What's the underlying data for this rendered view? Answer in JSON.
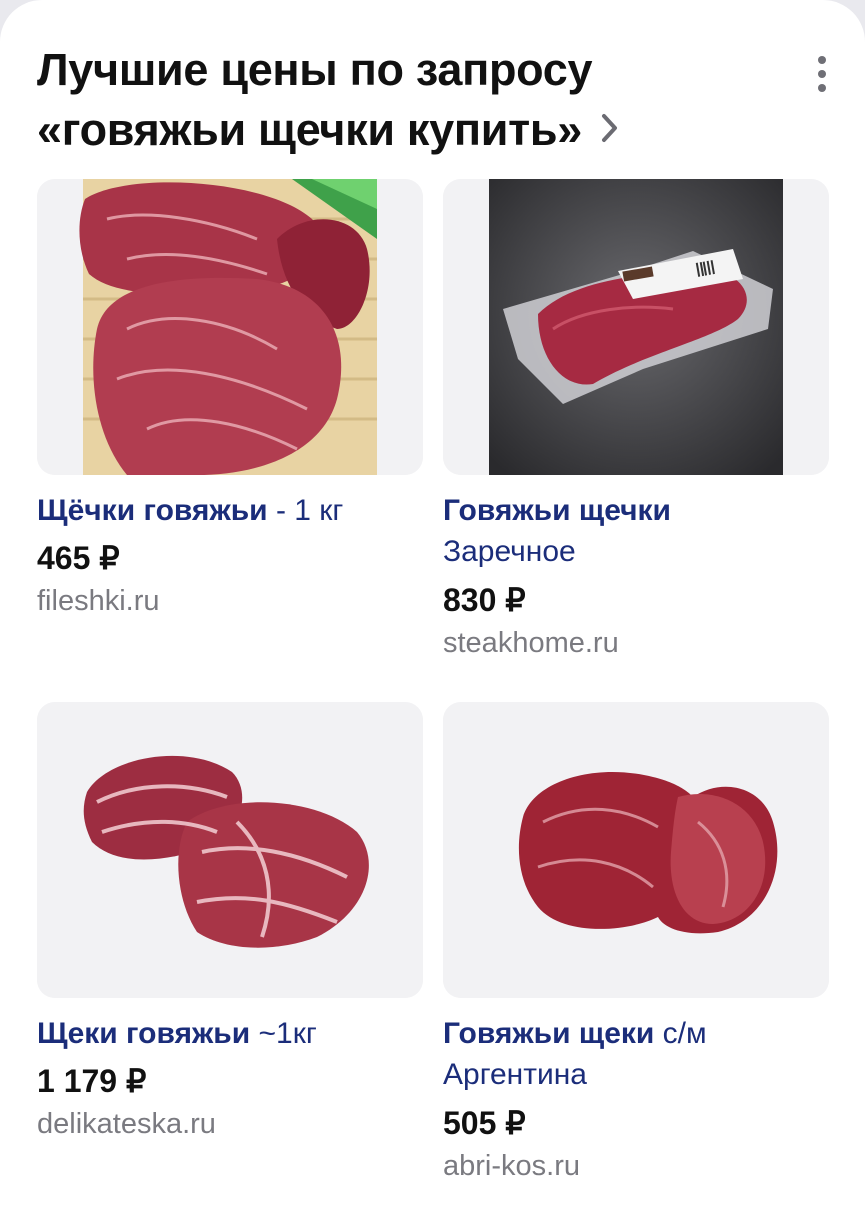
{
  "header": {
    "title_line1": "Лучшие цены по запросу",
    "title_line2": "«говяжьи щечки купить»"
  },
  "products": [
    {
      "name_bold": "Щёчки говяжьи",
      "name_rest": " - 1 кг",
      "subtitle": "",
      "price": "465 ₽",
      "site": "fileshki.ru"
    },
    {
      "name_bold": "Говяжьи щечки",
      "name_rest": "",
      "subtitle": "Заречное",
      "price": "830 ₽",
      "site": "steakhome.ru"
    },
    {
      "name_bold": "Щеки говяжьи",
      "name_rest": " ~1кг",
      "subtitle": "",
      "price": "1 179 ₽",
      "site": "delikateska.ru"
    },
    {
      "name_bold": "Говяжьи щеки",
      "name_rest": " с/м",
      "subtitle": "Аргентина",
      "price": "505 ₽",
      "site": "abri-kos.ru"
    }
  ],
  "icons": {
    "title_arrow": "chevron-right-icon",
    "menu": "more-vertical-icon"
  }
}
